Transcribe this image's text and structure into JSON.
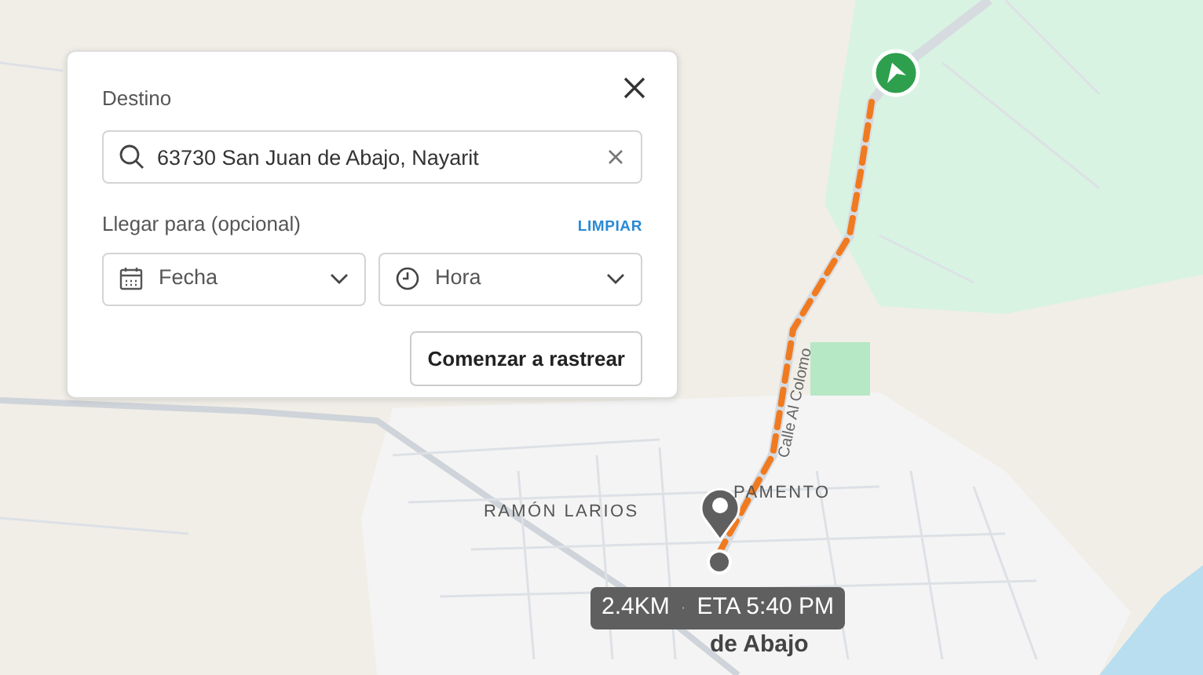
{
  "destination_panel": {
    "label": "Destino",
    "search": {
      "value": "63730 San Juan de Abajo, Nayarit"
    },
    "arrive_label": "Llegar para (opcional)",
    "clear_link": "LIMPIAR",
    "date_select": {
      "value": "Fecha"
    },
    "time_select": {
      "value": "Hora"
    },
    "start_button": "Comenzar a rastrear"
  },
  "map": {
    "labels": [
      {
        "text": "RAMÓN LARIOS",
        "kind": "area"
      },
      {
        "text": "PAMENTO",
        "kind": "area"
      },
      {
        "text": "Calle Al Colomo",
        "kind": "road"
      },
      {
        "text": "de Abajo",
        "kind": "town"
      }
    ]
  },
  "eta": {
    "distance": "2.4KM",
    "separator": "·",
    "time": "ETA 5:40 PM"
  }
}
